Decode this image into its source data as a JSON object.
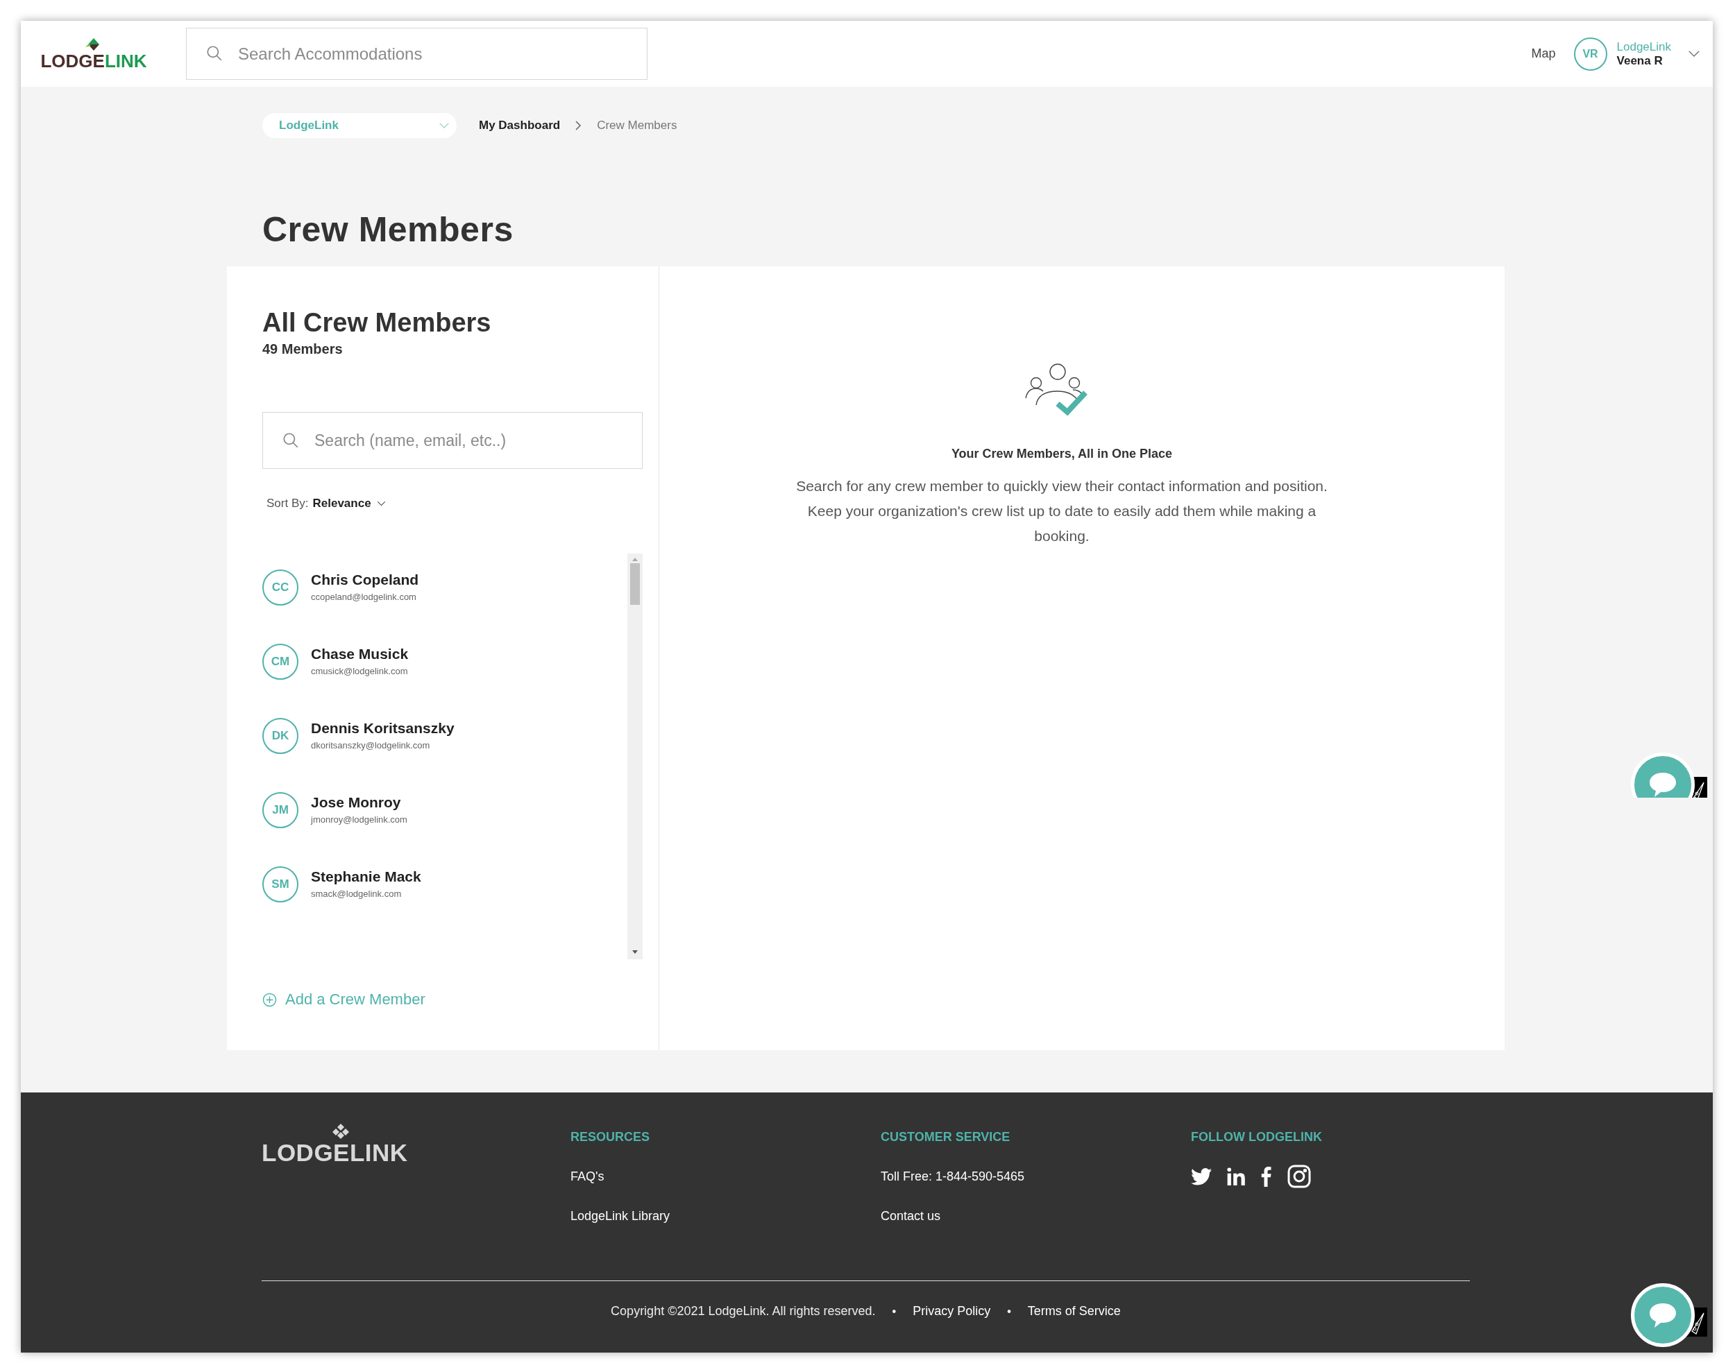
{
  "header": {
    "logo": {
      "first": "LODGE",
      "second": "LINK"
    },
    "search": {
      "placeholder": "Search Accommodations"
    },
    "map_link": "Map",
    "user": {
      "initials": "VR",
      "organization": "LodgeLink",
      "name": "Veena R"
    }
  },
  "breadcrumb": {
    "org_select": "LodgeLink",
    "items": [
      {
        "label": "My Dashboard",
        "current": false
      },
      {
        "label": "Crew Members",
        "current": true
      }
    ]
  },
  "page_title": "Crew Members",
  "crew_panel": {
    "title": "All Crew Members",
    "count": "49 Members",
    "search": {
      "placeholder": "Search (name, email, etc..)"
    },
    "sort_label": "Sort By:",
    "sort_value": "Relevance",
    "members": [
      {
        "initials": "CC",
        "name": "Chris Copeland",
        "email": "ccopeland@lodgelink.com"
      },
      {
        "initials": "CM",
        "name": "Chase Musick",
        "email": "cmusick@lodgelink.com"
      },
      {
        "initials": "DK",
        "name": "Dennis Koritsanszky",
        "email": "dkoritsanszky@lodgelink.com"
      },
      {
        "initials": "JM",
        "name": "Jose Monroy",
        "email": "jmonroy@lodgelink.com"
      },
      {
        "initials": "SM",
        "name": "Stephanie Mack",
        "email": "smack@lodgelink.com"
      }
    ],
    "add_button": "Add a Crew Member"
  },
  "empty_state": {
    "heading": "Your Crew Members, All in One Place",
    "text": "Search for any crew member to quickly view their contact information and position. Keep your organization's crew list up to date to easily add them while making a booking."
  },
  "footer": {
    "logo": "LODGELINK",
    "columns": [
      {
        "kind": "links",
        "heading": "RESOURCES",
        "links": [
          "FAQ's",
          "LodgeLink Library"
        ]
      },
      {
        "kind": "links",
        "heading": "CUSTOMER SERVICE",
        "links": [
          "Toll Free: 1-844-590-5465",
          "Contact us"
        ]
      },
      {
        "kind": "social",
        "heading": "FOLLOW LODGELINK"
      }
    ],
    "bottom": [
      {
        "kind": "text",
        "text": "Copyright ©2021 LodgeLink. All rights reserved."
      },
      {
        "kind": "separator",
        "text": "•"
      },
      {
        "kind": "link",
        "text": "Privacy Policy"
      },
      {
        "kind": "separator",
        "text": "•"
      },
      {
        "kind": "link",
        "text": "Terms of Service"
      }
    ]
  }
}
